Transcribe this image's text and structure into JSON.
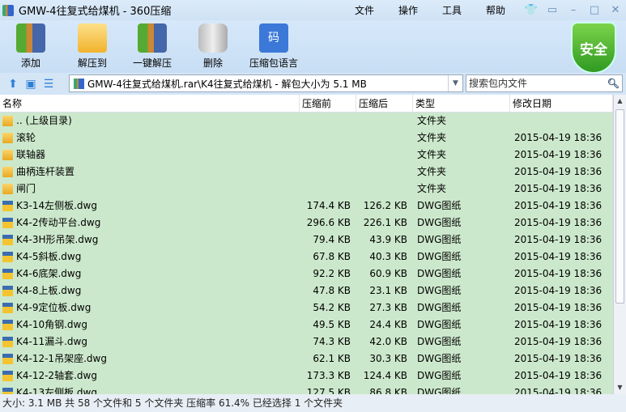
{
  "window": {
    "title": "GMW-4往复式给煤机 - 360压缩",
    "menu": [
      "文件",
      "操作",
      "工具",
      "帮助"
    ],
    "controls": [
      "skin-icon",
      "feedback-icon",
      "minimize-icon",
      "maximize-icon",
      "close-icon"
    ]
  },
  "toolbar": {
    "buttons": [
      {
        "label": "添加",
        "icon": "add-archive-icon"
      },
      {
        "label": "解压到",
        "icon": "extract-to-icon"
      },
      {
        "label": "一键解压",
        "icon": "one-click-extract-icon"
      },
      {
        "label": "删除",
        "icon": "trash-icon"
      },
      {
        "label": "压缩包语言",
        "icon": "encoding-icon"
      }
    ],
    "security_badge": "安全"
  },
  "address": {
    "path": "GMW-4往复式给煤机.rar\\K4往复式给煤机 - 解包大小为 5.1 MB",
    "search_placeholder": "搜索包内文件"
  },
  "columns": [
    "名称",
    "压缩前",
    "压缩后",
    "类型",
    "修改日期"
  ],
  "files": [
    {
      "name": ".. (上级目录)",
      "size": "",
      "packed": "",
      "type": "文件夹",
      "date": "",
      "kind": "folder"
    },
    {
      "name": "滚轮",
      "size": "",
      "packed": "",
      "type": "文件夹",
      "date": "2015-04-19 18:36",
      "kind": "folder"
    },
    {
      "name": "联轴器",
      "size": "",
      "packed": "",
      "type": "文件夹",
      "date": "2015-04-19 18:36",
      "kind": "folder"
    },
    {
      "name": "曲柄连杆装置",
      "size": "",
      "packed": "",
      "type": "文件夹",
      "date": "2015-04-19 18:36",
      "kind": "folder"
    },
    {
      "name": "闸门",
      "size": "",
      "packed": "",
      "type": "文件夹",
      "date": "2015-04-19 18:36",
      "kind": "folder"
    },
    {
      "name": "K3-14左侧板.dwg",
      "size": "174.4 KB",
      "packed": "126.2 KB",
      "type": "DWG图纸",
      "date": "2015-04-19 18:36",
      "kind": "dwg"
    },
    {
      "name": "K4-2传动平台.dwg",
      "size": "296.6 KB",
      "packed": "226.1 KB",
      "type": "DWG图纸",
      "date": "2015-04-19 18:36",
      "kind": "dwg"
    },
    {
      "name": "K4-3H形吊架.dwg",
      "size": "79.4 KB",
      "packed": "43.9 KB",
      "type": "DWG图纸",
      "date": "2015-04-19 18:36",
      "kind": "dwg"
    },
    {
      "name": "K4-5斜板.dwg",
      "size": "67.8 KB",
      "packed": "40.3 KB",
      "type": "DWG图纸",
      "date": "2015-04-19 18:36",
      "kind": "dwg"
    },
    {
      "name": "K4-6底架.dwg",
      "size": "92.2 KB",
      "packed": "60.9 KB",
      "type": "DWG图纸",
      "date": "2015-04-19 18:36",
      "kind": "dwg"
    },
    {
      "name": "K4-8上板.dwg",
      "size": "47.8 KB",
      "packed": "23.1 KB",
      "type": "DWG图纸",
      "date": "2015-04-19 18:36",
      "kind": "dwg"
    },
    {
      "name": "K4-9定位板.dwg",
      "size": "54.2 KB",
      "packed": "27.3 KB",
      "type": "DWG图纸",
      "date": "2015-04-19 18:36",
      "kind": "dwg"
    },
    {
      "name": "K4-10角钢.dwg",
      "size": "49.5 KB",
      "packed": "24.4 KB",
      "type": "DWG图纸",
      "date": "2015-04-19 18:36",
      "kind": "dwg"
    },
    {
      "name": "K4-11漏斗.dwg",
      "size": "74.3 KB",
      "packed": "42.0 KB",
      "type": "DWG图纸",
      "date": "2015-04-19 18:36",
      "kind": "dwg"
    },
    {
      "name": "K4-12-1吊架座.dwg",
      "size": "62.1 KB",
      "packed": "30.3 KB",
      "type": "DWG图纸",
      "date": "2015-04-19 18:36",
      "kind": "dwg"
    },
    {
      "name": "K4-12-2轴套.dwg",
      "size": "173.3 KB",
      "packed": "124.4 KB",
      "type": "DWG图纸",
      "date": "2015-04-19 18:36",
      "kind": "dwg"
    },
    {
      "name": "K4-13左侧板.dwg",
      "size": "127.5 KB",
      "packed": "86.8 KB",
      "type": "DWG图纸",
      "date": "2015-04-19 18:36",
      "kind": "dwg"
    }
  ],
  "status": "大小: 3.1 MB 共 58 个文件和 5 个文件夹 压缩率 61.4% 已经选择 1 个文件夹",
  "colors": {
    "selection": "#cce8cc",
    "chrome": "#d4e5f6",
    "accent": "#2f7fd7",
    "shield": "#3aa82a"
  }
}
